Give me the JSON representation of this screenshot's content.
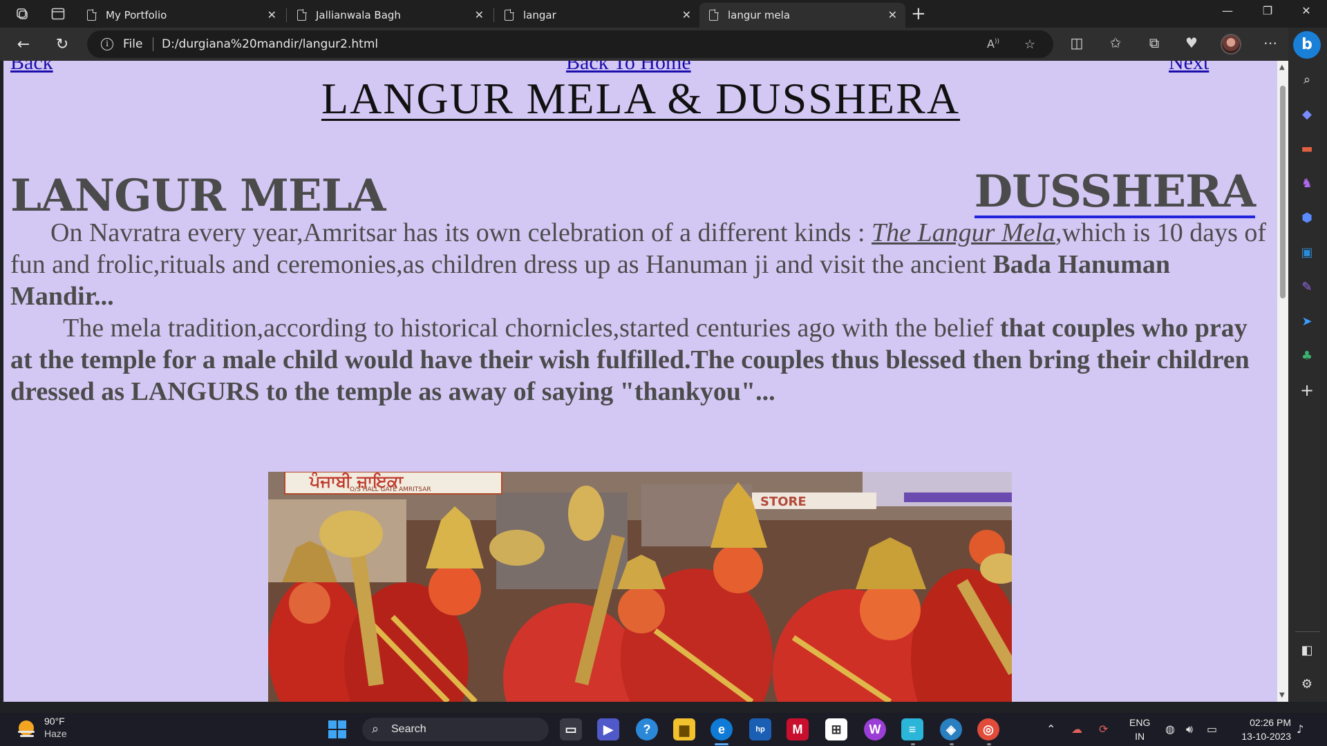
{
  "browser": {
    "tabs": [
      {
        "title": "My Portfolio",
        "active": false
      },
      {
        "title": "Jallianwala Bagh",
        "active": false
      },
      {
        "title": "langar",
        "active": false
      },
      {
        "title": "langur mela",
        "active": true
      }
    ],
    "address": {
      "scheme_label": "File",
      "url": "D:/durgiana%20mandir/langur2.html"
    }
  },
  "page": {
    "nav": {
      "back": "Back",
      "home": "Back To Home",
      "next": "Next"
    },
    "title": "LANGUR MELA & DUSSHERA",
    "heading_left": "LANGUR MELA",
    "heading_right": "DUSSHERA",
    "paragraph1": {
      "text_a": "On Navratra every year,Amritsar has its own celebration of a different kinds : ",
      "text_em": "The Langur Mela",
      "text_b": ",which is 10 days of fun and frolic,rituals and ceremonies,as children dress up as Hanuman ji and visit the ancient ",
      "text_bold": "Bada Hanuman Mandir..."
    },
    "paragraph2": {
      "text_a": "The mela tradition,according to historical chornicles,started centuries ago with the belief ",
      "text_bold": "that couples who pray at the temple for a male child would have their wish fulfilled.The couples thus blessed then bring their children dressed as LANGURS to the temple as away of saying \"thankyou\"..."
    },
    "photo_sign_text": "ਪੰਜਾਬੀ ਜ਼ਾਇਕਾ",
    "photo_sign_sub": "O/S HALL GATE AMRITSAR",
    "photo_shop_text": "STORE",
    "background_color": "#d3c8f4"
  },
  "taskbar": {
    "weather": {
      "temp": "90°F",
      "condition": "Haze"
    },
    "search_label": "Search",
    "language": {
      "line1": "ENG",
      "line2": "IN"
    },
    "clock": {
      "time": "02:26 PM",
      "date": "13-10-2023"
    }
  }
}
